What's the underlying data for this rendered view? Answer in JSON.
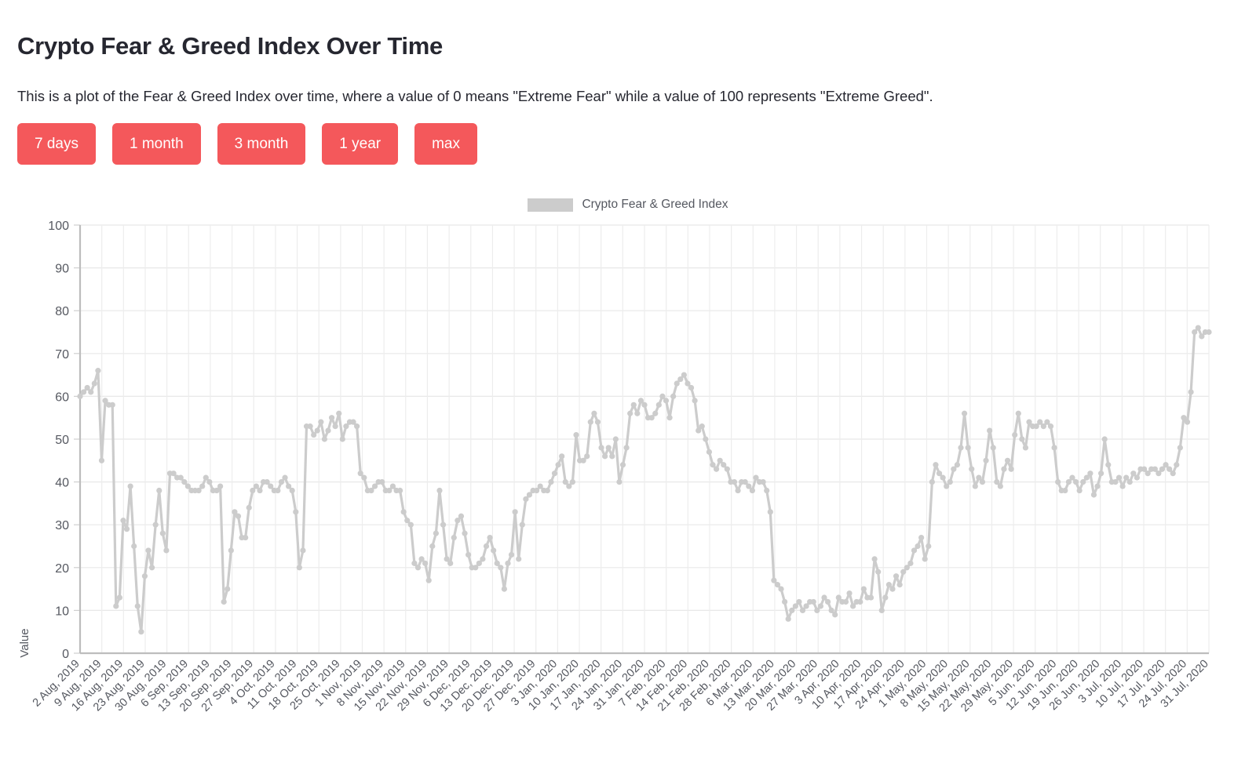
{
  "header": {
    "title": "Crypto Fear & Greed Index Over Time",
    "subtitle": "This is a plot of the Fear & Greed Index over time, where a value of 0 means \"Extreme Fear\" while a value of 100 represents \"Extreme Greed\"."
  },
  "controls": {
    "buttons": [
      {
        "label": "7 days"
      },
      {
        "label": "1 month"
      },
      {
        "label": "3 month"
      },
      {
        "label": "1 year"
      },
      {
        "label": "max"
      }
    ],
    "accent_color": "#f4585b",
    "accent_text_color": "#ffffff"
  },
  "chart_data": {
    "type": "line",
    "title": "",
    "xlabel": "",
    "ylabel": "Value",
    "ylim": [
      0,
      100
    ],
    "yticks": [
      0,
      10,
      20,
      30,
      40,
      50,
      60,
      70,
      80,
      90,
      100
    ],
    "grid": true,
    "legend_position": "top-center",
    "series_color": "#cccccc",
    "marker": "circle",
    "series": [
      {
        "name": "Crypto Fear & Greed Index",
        "x_tick_labels": [
          "2 Aug, 2019",
          "9 Aug, 2019",
          "16 Aug, 2019",
          "23 Aug, 2019",
          "30 Aug, 2019",
          "6 Sep, 2019",
          "13 Sep, 2019",
          "20 Sep, 2019",
          "27 Sep, 2019",
          "4 Oct, 2019",
          "11 Oct, 2019",
          "18 Oct, 2019",
          "25 Oct, 2019",
          "1 Nov, 2019",
          "8 Nov, 2019",
          "15 Nov, 2019",
          "22 Nov, 2019",
          "29 Nov, 2019",
          "6 Dec, 2019",
          "13 Dec, 2019",
          "20 Dec, 2019",
          "27 Dec, 2019",
          "3 Jan, 2020",
          "10 Jan, 2020",
          "17 Jan, 2020",
          "24 Jan, 2020",
          "31 Jan, 2020",
          "7 Feb, 2020",
          "14 Feb, 2020",
          "21 Feb, 2020",
          "28 Feb, 2020",
          "6 Mar, 2020",
          "13 Mar, 2020",
          "20 Mar, 2020",
          "27 Mar, 2020",
          "3 Apr, 2020",
          "10 Apr, 2020",
          "17 Apr, 2020",
          "24 Apr, 2020",
          "1 May, 2020",
          "8 May, 2020",
          "15 May, 2020",
          "22 May, 2020",
          "29 May, 2020",
          "5 Jun, 2020",
          "12 Jun, 2020",
          "19 Jun, 2020",
          "26 Jun, 2020",
          "3 Jul, 2020",
          "10 Jul, 2020",
          "17 Jul, 2020",
          "24 Jul, 2020",
          "31 Jul, 2020"
        ],
        "x_start": "2019-08-02",
        "x_end": "2020-08-01",
        "sampling": "daily",
        "values": [
          60,
          61,
          62,
          61,
          63,
          66,
          45,
          59,
          58,
          58,
          11,
          13,
          31,
          29,
          39,
          25,
          11,
          5,
          18,
          24,
          20,
          30,
          38,
          28,
          24,
          42,
          42,
          41,
          41,
          40,
          39,
          38,
          38,
          38,
          39,
          41,
          40,
          38,
          38,
          39,
          12,
          15,
          24,
          33,
          32,
          27,
          27,
          34,
          38,
          39,
          38,
          40,
          40,
          39,
          38,
          38,
          40,
          41,
          39,
          38,
          33,
          20,
          24,
          53,
          53,
          51,
          52,
          54,
          50,
          52,
          55,
          53,
          56,
          50,
          53,
          54,
          54,
          53,
          42,
          41,
          38,
          38,
          39,
          40,
          40,
          38,
          38,
          39,
          38,
          38,
          33,
          31,
          30,
          21,
          20,
          22,
          21,
          17,
          25,
          28,
          38,
          30,
          22,
          21,
          27,
          31,
          32,
          28,
          23,
          20,
          20,
          21,
          22,
          25,
          27,
          24,
          21,
          20,
          15,
          21,
          23,
          33,
          22,
          30,
          36,
          37,
          38,
          38,
          39,
          38,
          38,
          40,
          42,
          44,
          46,
          40,
          39,
          40,
          51,
          45,
          45,
          46,
          54,
          56,
          54,
          48,
          46,
          48,
          46,
          50,
          40,
          44,
          48,
          56,
          58,
          56,
          59,
          58,
          55,
          55,
          56,
          58,
          60,
          59,
          55,
          60,
          63,
          64,
          65,
          63,
          62,
          59,
          52,
          53,
          50,
          47,
          44,
          43,
          45,
          44,
          43,
          40,
          40,
          38,
          40,
          40,
          39,
          38,
          41,
          40,
          40,
          38,
          33,
          17,
          16,
          15,
          12,
          8,
          10,
          11,
          12,
          10,
          11,
          12,
          12,
          10,
          11,
          13,
          12,
          10,
          9,
          13,
          12,
          12,
          14,
          11,
          12,
          12,
          15,
          13,
          13,
          22,
          19,
          10,
          13,
          16,
          15,
          18,
          16,
          19,
          20,
          21,
          24,
          25,
          27,
          22,
          25,
          40,
          44,
          42,
          41,
          39,
          40,
          43,
          44,
          48,
          56,
          48,
          43,
          39,
          41,
          40,
          45,
          52,
          48,
          40,
          39,
          43,
          45,
          43,
          51,
          56,
          50,
          48,
          54,
          53,
          53,
          54,
          53,
          54,
          53,
          48,
          40,
          38,
          38,
          40,
          41,
          40,
          38,
          40,
          41,
          42,
          37,
          39,
          42,
          50,
          44,
          40,
          40,
          41,
          39,
          41,
          40,
          42,
          41,
          43,
          43,
          42,
          43,
          43,
          42,
          43,
          44,
          43,
          42,
          44,
          48,
          55,
          54,
          61,
          75,
          76,
          74,
          75,
          75
        ]
      }
    ]
  }
}
